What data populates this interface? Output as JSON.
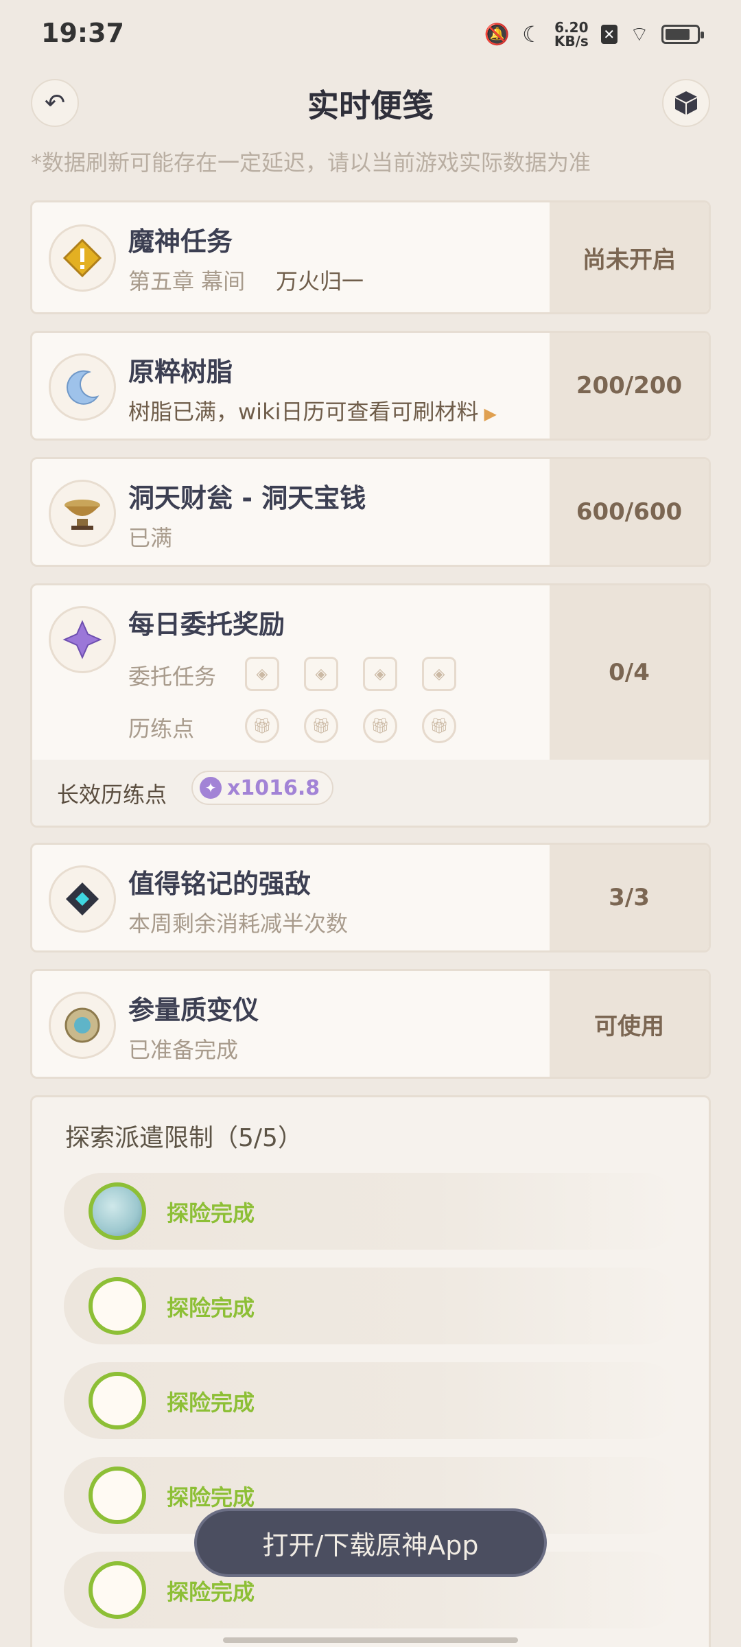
{
  "status_bar": {
    "time": "19:37",
    "net_speed_value": "6.20",
    "net_speed_unit": "KB/s",
    "icons": [
      "bell-muted-icon",
      "moon-icon",
      "close-box-icon",
      "wifi-icon",
      "battery-icon"
    ]
  },
  "header": {
    "title": "实时便笺",
    "back_icon": "back-arrow-icon",
    "right_icon": "cube-icon"
  },
  "notice": "*数据刷新可能存在一定延迟，请以当前游戏实际数据为准",
  "cards": {
    "archon": {
      "title": "魔神任务",
      "chapter": "第五章 幕间",
      "quest": "万火归一",
      "status": "尚未开启"
    },
    "resin": {
      "title": "原粹树脂",
      "subtitle": "树脂已满，wiki日历可查看可刷材料",
      "value": "200/200"
    },
    "realm": {
      "title": "洞天财瓮 - 洞天宝钱",
      "subtitle": "已满",
      "value": "600/600"
    },
    "daily": {
      "title": "每日委托奖励",
      "tasks_label": "委托任务",
      "points_label": "历练点",
      "value": "0/4",
      "footer_label": "长效历练点",
      "footer_value": "x1016.8"
    },
    "weekly": {
      "title": "值得铭记的强敌",
      "subtitle": "本周剩余消耗减半次数",
      "value": "3/3"
    },
    "transformer": {
      "title": "参量质变仪",
      "subtitle": "已准备完成",
      "status": "可使用"
    }
  },
  "expedition": {
    "title": "探索派遣限制（5/5）",
    "rows": [
      {
        "status": "探险完成"
      },
      {
        "status": "探险完成"
      },
      {
        "status": "探险完成"
      },
      {
        "status": "探险完成"
      },
      {
        "status": "探险完成"
      }
    ]
  },
  "float_button": "打开/下载原神App",
  "colors": {
    "accent_green": "#8dbf36",
    "brown": "#7b6652",
    "purple": "#a283d6",
    "bg": "#efe9e2"
  }
}
